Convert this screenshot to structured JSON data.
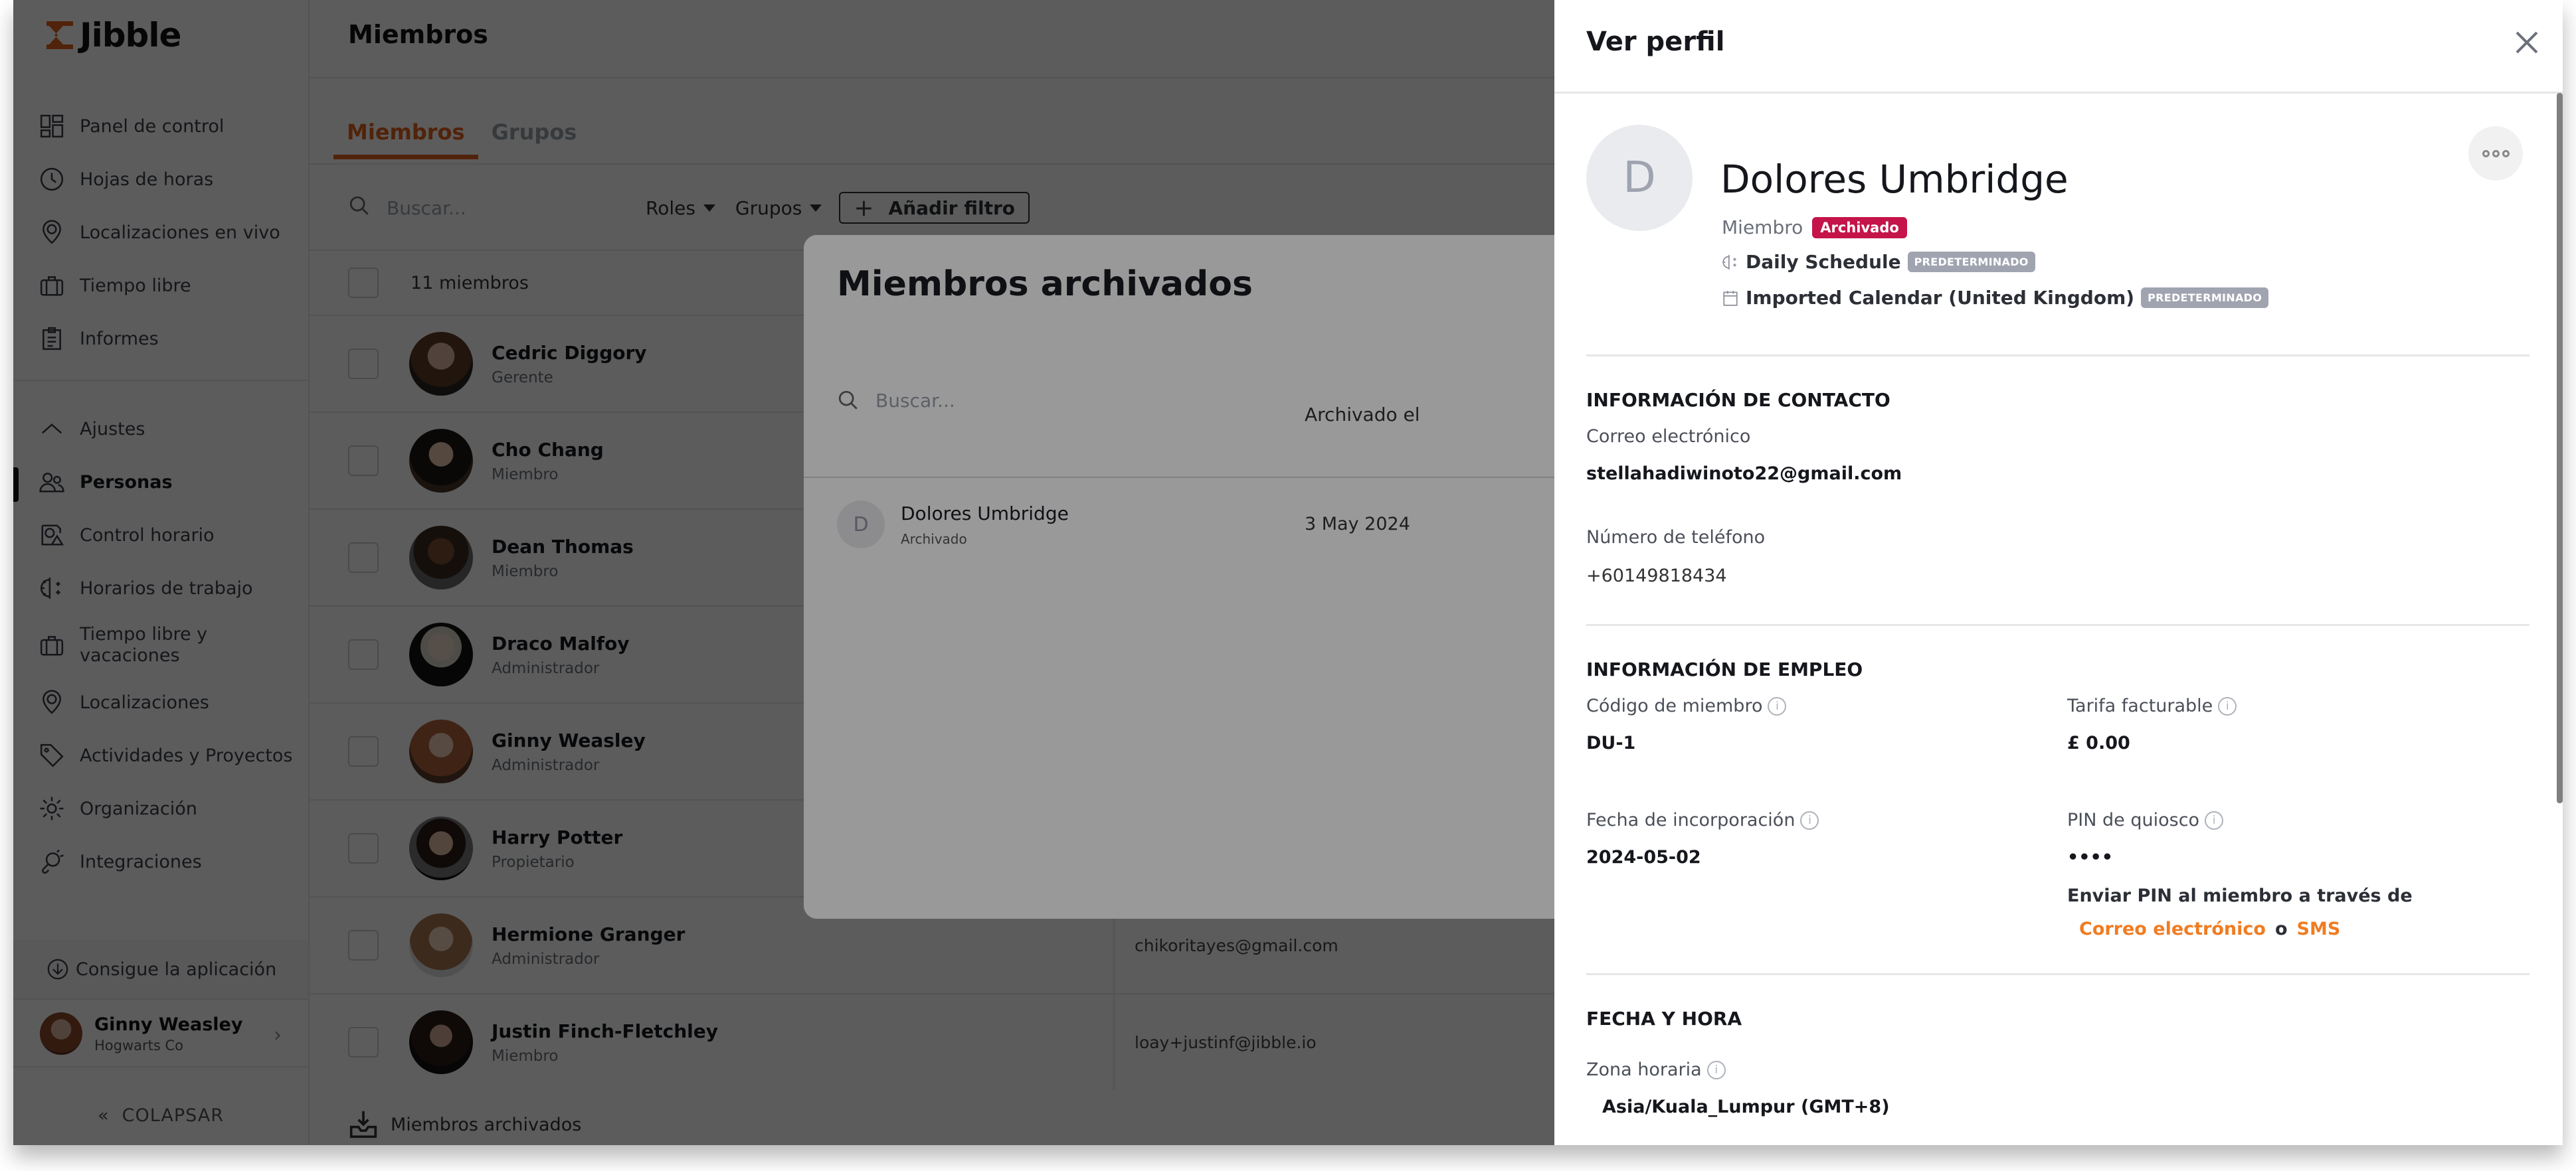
{
  "app": {
    "brand": "Jibble"
  },
  "sidebar": {
    "items_primary": [
      {
        "label": "Panel de control",
        "icon": "dashboard-icon"
      },
      {
        "label": "Hojas de horas",
        "icon": "clock-icon"
      },
      {
        "label": "Localizaciones en vivo",
        "icon": "map-pin-icon"
      },
      {
        "label": "Tiempo libre",
        "icon": "suitcase-icon"
      },
      {
        "label": "Informes",
        "icon": "clipboard-icon"
      }
    ],
    "settings_toggle": {
      "label": "Ajustes",
      "icon": "chevron-up-icon"
    },
    "items_settings": [
      {
        "label": "Personas",
        "icon": "people-icon",
        "active": true
      },
      {
        "label": "Control horario",
        "icon": "time-tracking-icon"
      },
      {
        "label": "Horarios de trabajo",
        "icon": "work-schedule-icon"
      },
      {
        "label": "Tiempo libre y vacaciones",
        "icon": "suitcase-icon"
      },
      {
        "label": "Localizaciones",
        "icon": "map-pin-icon"
      },
      {
        "label": "Actividades y Proyectos",
        "icon": "tag-icon"
      },
      {
        "label": "Organización",
        "icon": "gear-icon"
      },
      {
        "label": "Integraciones",
        "icon": "plug-icon"
      }
    ],
    "get_app": "Consigue la aplicación",
    "user": {
      "name": "Ginny Weasley",
      "org": "Hogwarts Co"
    },
    "collapse": "COLAPSAR"
  },
  "main": {
    "title": "Miembros",
    "tabs": [
      {
        "label": "Miembros",
        "active": true
      },
      {
        "label": "Grupos",
        "active": false
      }
    ],
    "search_placeholder": "Buscar...",
    "filters": {
      "roles": "Roles",
      "groups": "Grupos",
      "add_filter": "Añadir filtro"
    },
    "count_label": "11 miembros",
    "members": [
      {
        "name": "Cedric Diggory",
        "role": "Gerente",
        "email": ""
      },
      {
        "name": "Cho Chang",
        "role": "Miembro",
        "email": ""
      },
      {
        "name": "Dean Thomas",
        "role": "Miembro",
        "email": ""
      },
      {
        "name": "Draco Malfoy",
        "role": "Administrador",
        "email": ""
      },
      {
        "name": "Ginny Weasley",
        "role": "Administrador",
        "email": ""
      },
      {
        "name": "Harry Potter",
        "role": "Propietario",
        "email": ""
      },
      {
        "name": "Hermione Granger",
        "role": "Administrador",
        "email": "chikoritayes@gmail.com"
      },
      {
        "name": "Justin Finch-Fletchley",
        "role": "Miembro",
        "email": "loay+justinf@jibble.io"
      }
    ],
    "archived_link": "Miembros archivados"
  },
  "archived_modal": {
    "title": "Miembros archivados",
    "search_placeholder": "Buscar...",
    "column_archived_on": "Archivado el",
    "rows": [
      {
        "initial": "D",
        "name": "Dolores Umbridge",
        "status": "Archivado",
        "archived_on": "3 May 2024"
      }
    ]
  },
  "profile": {
    "panel_title": "Ver perfil",
    "initial": "D",
    "name": "Dolores Umbridge",
    "role": "Miembro",
    "status_badge": "Archivado",
    "schedule": "Daily Schedule",
    "calendar": "Imported Calendar (United Kingdom)",
    "default_badge": "PREDETERMINADO",
    "contact": {
      "title": "INFORMACIÓN DE CONTACTO",
      "email_label": "Correo electrónico",
      "email": "stellahadiwinoto22@gmail.com",
      "phone_label": "Número de teléfono",
      "phone": "+60149818434"
    },
    "employment": {
      "title": "INFORMACIÓN DE EMPLEO",
      "member_code_label": "Código de miembro",
      "member_code": "DU-1",
      "billable_rate_label": "Tarifa facturable",
      "billable_rate": "£ 0.00",
      "join_date_label": "Fecha de incorporación",
      "join_date": "2024-05-02",
      "kiosk_pin_label": "PIN de quiosco",
      "kiosk_pin": "••••",
      "send_pin_text": "Enviar PIN al miembro a través de",
      "send_pin_email": "Correo electrónico",
      "send_pin_or": "o",
      "send_pin_sms": "SMS"
    },
    "datetime": {
      "title": "FECHA Y HORA",
      "timezone_label": "Zona horaria",
      "timezone": "Asia/Kuala_Lumpur (GMT+8)"
    }
  },
  "colors": {
    "accent": "#e0631c",
    "archived_badge": "#c4144a",
    "default_badge": "#a0a4b0",
    "link": "#f07c22"
  }
}
